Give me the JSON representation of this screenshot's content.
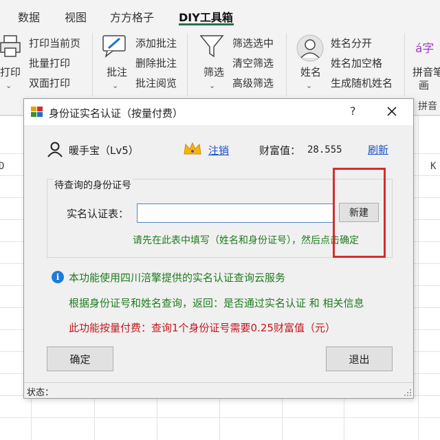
{
  "ribbon": {
    "tabs": [
      {
        "label": "数据",
        "active": false
      },
      {
        "label": "视图",
        "active": false
      },
      {
        "label": "方方格子",
        "active": false
      },
      {
        "label": "DIY工具箱",
        "active": true
      }
    ],
    "print_group": {
      "big_label": "打印",
      "items": [
        "打印当前页",
        "批量打印",
        "双面打印"
      ]
    },
    "comment_group": {
      "big_label": "批注",
      "items": [
        "添加批注",
        "删除批注",
        "批注阅览"
      ]
    },
    "filter_group": {
      "big_label": "筛选",
      "items": [
        "筛选选中",
        "清空筛选",
        "高级筛选"
      ]
    },
    "name_group": {
      "big_label": "姓名",
      "items": [
        "姓名分开",
        "姓名加空格",
        "生成随机姓名"
      ]
    },
    "pinyin_group": {
      "big_label": "拼音笔画",
      "big_label_line2": "画",
      "group_label": "拼音",
      "icon_text": "á字"
    }
  },
  "grid": {
    "left_col_letter": "D",
    "right_col_letter": "K"
  },
  "dialog": {
    "title": "身份证实名认证（按量付费）",
    "help": "?",
    "user": {
      "name": "暖手宝（Lv5）",
      "logout_link": "注销",
      "wealth_label": "财富值：",
      "wealth_value": "28.555",
      "refresh_link": "刷新"
    },
    "group_title": "待查询的身份证号",
    "field_label": "实名认证表：",
    "field_value": "",
    "new_button": "新建",
    "hint": "请先在此表中填写（姓名和身份证号），然后点击确定",
    "info_lines": [
      "本功能使用四川涪擎提供的实名认证查询云服务",
      "根据身份证号和姓名查询，返回：是否通过实名认证 和 相关信息",
      "此功能按量付费：查询1个身份证号需要0.25财富值（元）"
    ],
    "ok_button": "确定",
    "exit_button": "退出",
    "status_label": "状态："
  },
  "colors": {
    "accent_green": "#217346",
    "link_blue": "#1a4fc4",
    "hint_green": "#1e7b1e",
    "warn_red": "#c4161c",
    "highlight_red": "#d62b2b",
    "crown_gold": "#f5b800"
  }
}
